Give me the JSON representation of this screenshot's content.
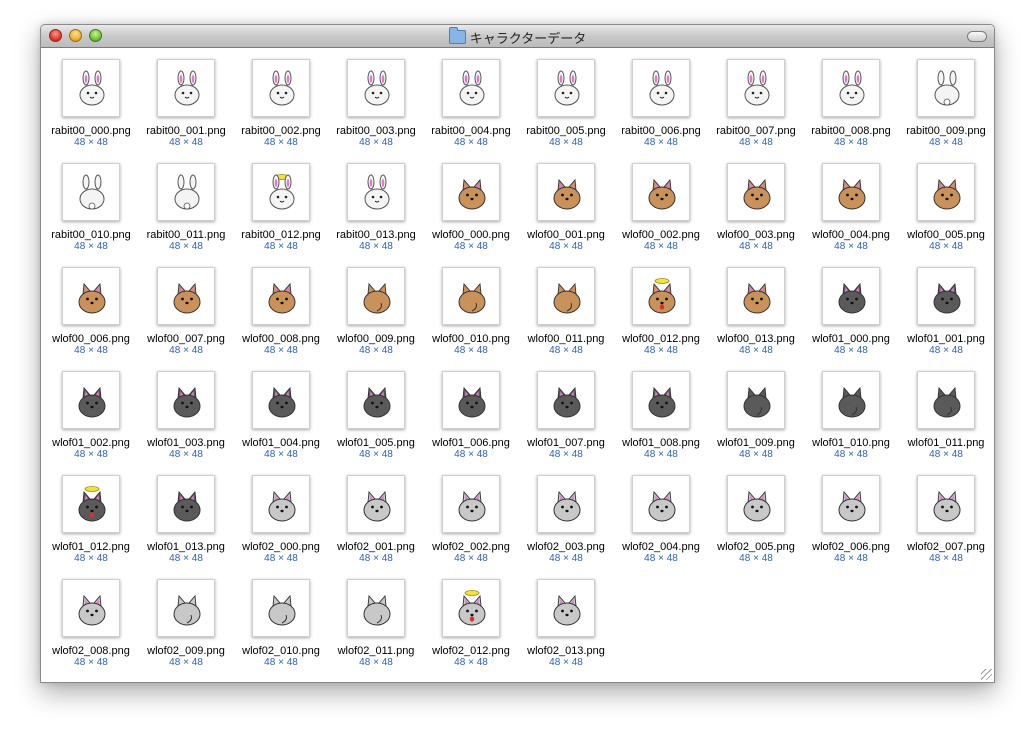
{
  "window": {
    "title": "キャラクターデータ"
  },
  "files": [
    {
      "name": "rabit00_000.png",
      "size": "48 × 48",
      "kind": "rabbit"
    },
    {
      "name": "rabit00_001.png",
      "size": "48 × 48",
      "kind": "rabbit"
    },
    {
      "name": "rabit00_002.png",
      "size": "48 × 48",
      "kind": "rabbit"
    },
    {
      "name": "rabit00_003.png",
      "size": "48 × 48",
      "kind": "rabbit"
    },
    {
      "name": "rabit00_004.png",
      "size": "48 × 48",
      "kind": "rabbit"
    },
    {
      "name": "rabit00_005.png",
      "size": "48 × 48",
      "kind": "rabbit"
    },
    {
      "name": "rabit00_006.png",
      "size": "48 × 48",
      "kind": "rabbit"
    },
    {
      "name": "rabit00_007.png",
      "size": "48 × 48",
      "kind": "rabbit"
    },
    {
      "name": "rabit00_008.png",
      "size": "48 × 48",
      "kind": "rabbit"
    },
    {
      "name": "rabit00_009.png",
      "size": "48 × 48",
      "kind": "rabbit-back"
    },
    {
      "name": "rabit00_010.png",
      "size": "48 × 48",
      "kind": "rabbit-back"
    },
    {
      "name": "rabit00_011.png",
      "size": "48 × 48",
      "kind": "rabbit-back"
    },
    {
      "name": "rabit00_012.png",
      "size": "48 × 48",
      "kind": "rabbit-halo"
    },
    {
      "name": "rabit00_013.png",
      "size": "48 × 48",
      "kind": "rabbit"
    },
    {
      "name": "wlof00_000.png",
      "size": "48 × 48",
      "kind": "wolf-brown"
    },
    {
      "name": "wlof00_001.png",
      "size": "48 × 48",
      "kind": "wolf-brown"
    },
    {
      "name": "wlof00_002.png",
      "size": "48 × 48",
      "kind": "wolf-brown"
    },
    {
      "name": "wlof00_003.png",
      "size": "48 × 48",
      "kind": "wolf-brown"
    },
    {
      "name": "wlof00_004.png",
      "size": "48 × 48",
      "kind": "wolf-brown"
    },
    {
      "name": "wlof00_005.png",
      "size": "48 × 48",
      "kind": "wolf-brown"
    },
    {
      "name": "wlof00_006.png",
      "size": "48 × 48",
      "kind": "wolf-brown"
    },
    {
      "name": "wlof00_007.png",
      "size": "48 × 48",
      "kind": "wolf-brown"
    },
    {
      "name": "wlof00_008.png",
      "size": "48 × 48",
      "kind": "wolf-brown"
    },
    {
      "name": "wlof00_009.png",
      "size": "48 × 48",
      "kind": "wolf-brown-back"
    },
    {
      "name": "wlof00_010.png",
      "size": "48 × 48",
      "kind": "wolf-brown-back"
    },
    {
      "name": "wlof00_011.png",
      "size": "48 × 48",
      "kind": "wolf-brown-back"
    },
    {
      "name": "wlof00_012.png",
      "size": "48 × 48",
      "kind": "wolf-brown-halo"
    },
    {
      "name": "wlof00_013.png",
      "size": "48 × 48",
      "kind": "wolf-brown"
    },
    {
      "name": "wlof01_000.png",
      "size": "48 × 48",
      "kind": "wolf-dark"
    },
    {
      "name": "wlof01_001.png",
      "size": "48 × 48",
      "kind": "wolf-dark"
    },
    {
      "name": "wlof01_002.png",
      "size": "48 × 48",
      "kind": "wolf-dark"
    },
    {
      "name": "wlof01_003.png",
      "size": "48 × 48",
      "kind": "wolf-dark"
    },
    {
      "name": "wlof01_004.png",
      "size": "48 × 48",
      "kind": "wolf-dark"
    },
    {
      "name": "wlof01_005.png",
      "size": "48 × 48",
      "kind": "wolf-dark"
    },
    {
      "name": "wlof01_006.png",
      "size": "48 × 48",
      "kind": "wolf-dark"
    },
    {
      "name": "wlof01_007.png",
      "size": "48 × 48",
      "kind": "wolf-dark"
    },
    {
      "name": "wlof01_008.png",
      "size": "48 × 48",
      "kind": "wolf-dark"
    },
    {
      "name": "wlof01_009.png",
      "size": "48 × 48",
      "kind": "wolf-dark-back"
    },
    {
      "name": "wlof01_010.png",
      "size": "48 × 48",
      "kind": "wolf-dark-back"
    },
    {
      "name": "wlof01_011.png",
      "size": "48 × 48",
      "kind": "wolf-dark-back"
    },
    {
      "name": "wlof01_012.png",
      "size": "48 × 48",
      "kind": "wolf-dark-halo"
    },
    {
      "name": "wlof01_013.png",
      "size": "48 × 48",
      "kind": "wolf-dark"
    },
    {
      "name": "wlof02_000.png",
      "size": "48 × 48",
      "kind": "wolf-light"
    },
    {
      "name": "wlof02_001.png",
      "size": "48 × 48",
      "kind": "wolf-light"
    },
    {
      "name": "wlof02_002.png",
      "size": "48 × 48",
      "kind": "wolf-light"
    },
    {
      "name": "wlof02_003.png",
      "size": "48 × 48",
      "kind": "wolf-light"
    },
    {
      "name": "wlof02_004.png",
      "size": "48 × 48",
      "kind": "wolf-light"
    },
    {
      "name": "wlof02_005.png",
      "size": "48 × 48",
      "kind": "wolf-light"
    },
    {
      "name": "wlof02_006.png",
      "size": "48 × 48",
      "kind": "wolf-light"
    },
    {
      "name": "wlof02_007.png",
      "size": "48 × 48",
      "kind": "wolf-light"
    },
    {
      "name": "wlof02_008.png",
      "size": "48 × 48",
      "kind": "wolf-light"
    },
    {
      "name": "wlof02_009.png",
      "size": "48 × 48",
      "kind": "wolf-light-back"
    },
    {
      "name": "wlof02_010.png",
      "size": "48 × 48",
      "kind": "wolf-light-back"
    },
    {
      "name": "wlof02_011.png",
      "size": "48 × 48",
      "kind": "wolf-light-back"
    },
    {
      "name": "wlof02_012.png",
      "size": "48 × 48",
      "kind": "wolf-light-halo"
    },
    {
      "name": "wlof02_013.png",
      "size": "48 × 48",
      "kind": "wolf-light"
    }
  ],
  "colors": {
    "rabbit": "#f4f4f4",
    "wolf-brown": "#c9925a",
    "wolf-dark": "#5a5a5a",
    "wolf-light": "#c8c8c8",
    "ear_pink": "#e07ad0",
    "halo": "#f2e23a",
    "size_label": "#2d62b6"
  }
}
